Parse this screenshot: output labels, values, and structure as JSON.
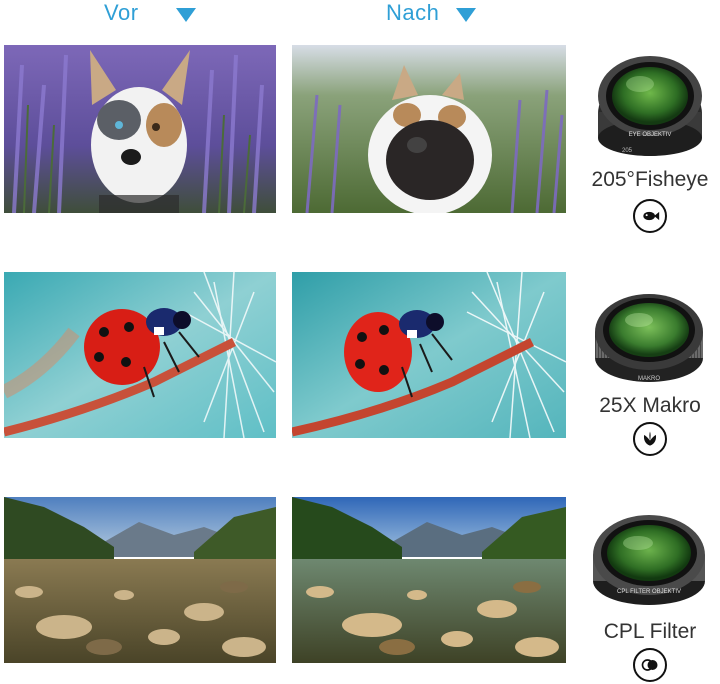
{
  "header": {
    "before_label": "Vor",
    "after_label": "Nach"
  },
  "rows": [
    {
      "lens_label": "205°Fisheye",
      "lens_ring_text": "EYE OBJEKTIV",
      "lens_sub_text": "205",
      "icon": "fish-icon"
    },
    {
      "lens_label": "25X Makro",
      "lens_ring_text": "MAKRO",
      "lens_sub_text": "",
      "icon": "flower-icon"
    },
    {
      "lens_label": "CPL Filter",
      "lens_ring_text": "CPL FILTER OBJEKTIV",
      "lens_sub_text": "",
      "icon": "polarizer-icon"
    }
  ],
  "colors": {
    "accent": "#2f9fd6",
    "lens_green": "#3f8a2e"
  }
}
